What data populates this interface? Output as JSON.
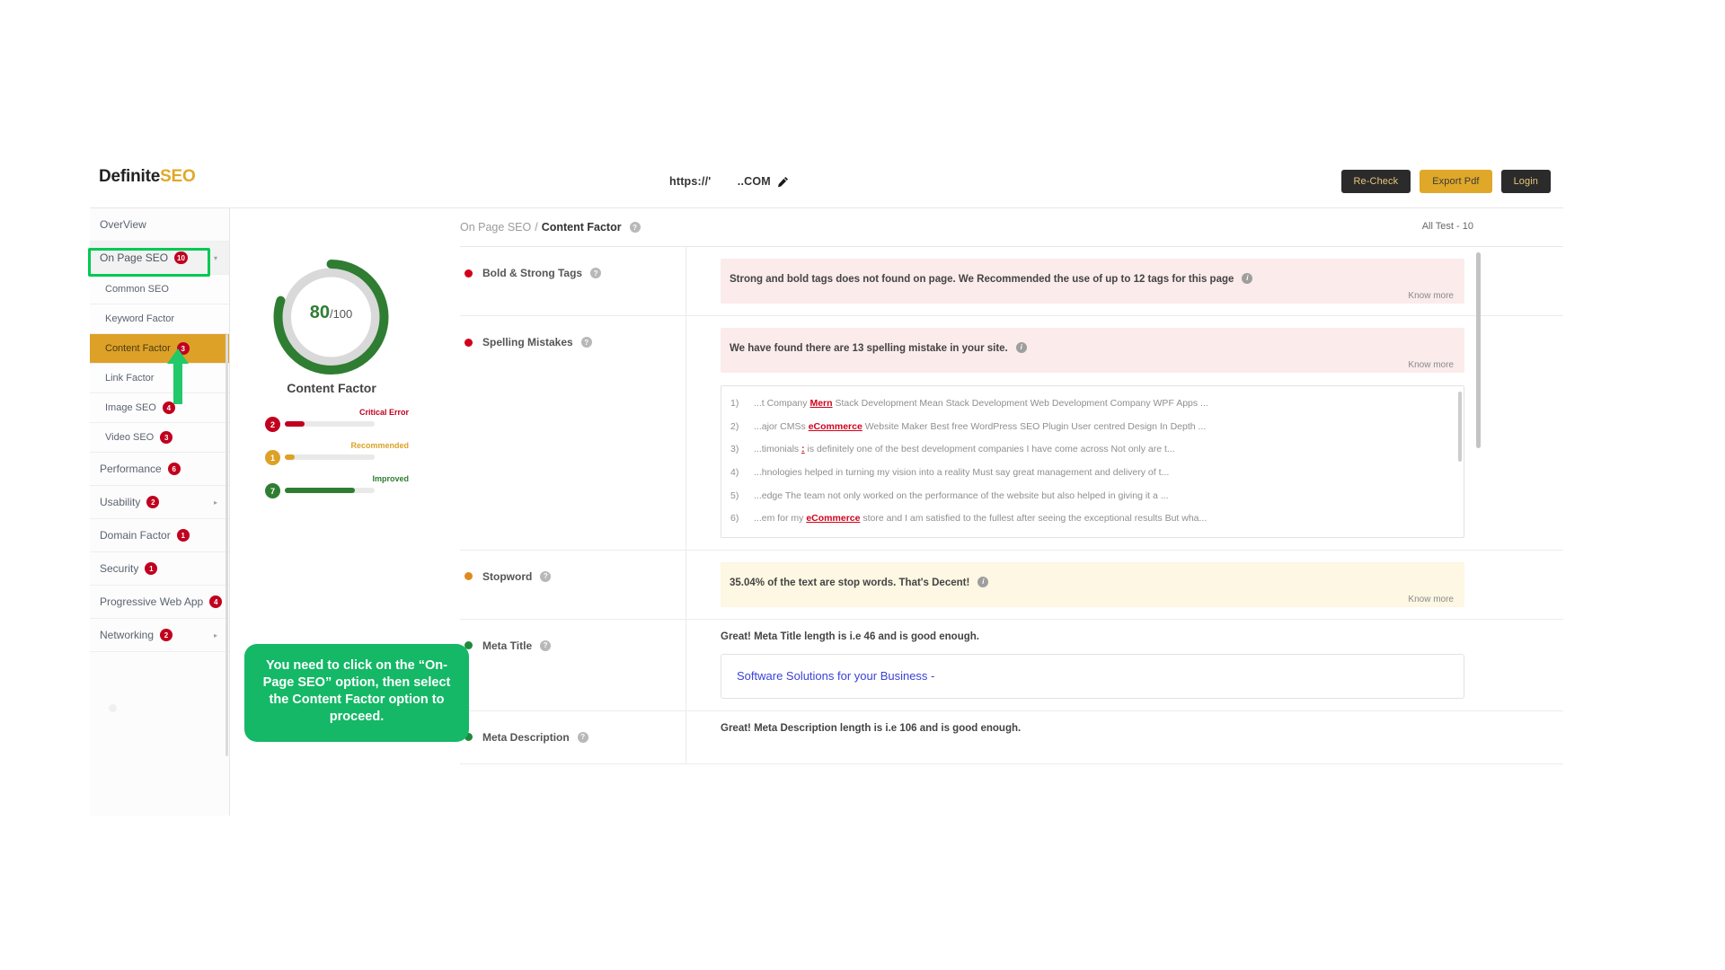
{
  "header": {
    "logo_primary": "Definite",
    "logo_accent": "SEO",
    "url": "https://'        ..COM",
    "edit_icon": "pencil-icon",
    "buttons": {
      "recheck": "Re-Check",
      "export": "Export Pdf",
      "login": "Login"
    }
  },
  "sidebar": {
    "items": [
      {
        "label": "OverView",
        "badge": "",
        "caret": "",
        "state": "normal"
      },
      {
        "label": "On Page SEO",
        "badge": "10",
        "caret": "▾",
        "state": "group-open"
      },
      {
        "label": "Common SEO",
        "badge": "",
        "caret": "",
        "state": "sub"
      },
      {
        "label": "Keyword Factor",
        "badge": "",
        "caret": "",
        "state": "sub"
      },
      {
        "label": "Content Factor",
        "badge": "3",
        "caret": "",
        "state": "sub-active"
      },
      {
        "label": "Link Factor",
        "badge": "",
        "caret": "",
        "state": "sub"
      },
      {
        "label": "Image SEO",
        "badge": "4",
        "caret": "",
        "state": "sub"
      },
      {
        "label": "Video SEO",
        "badge": "3",
        "caret": "",
        "state": "sub"
      },
      {
        "label": "Performance",
        "badge": "6",
        "caret": "",
        "state": "normal"
      },
      {
        "label": "Usability",
        "badge": "2",
        "caret": "▸",
        "state": "normal"
      },
      {
        "label": "Domain Factor",
        "badge": "1",
        "caret": "",
        "state": "normal"
      },
      {
        "label": "Security",
        "badge": "1",
        "caret": "",
        "state": "normal"
      },
      {
        "label": "Progressive Web App",
        "badge": "4",
        "caret": "",
        "state": "normal"
      },
      {
        "label": "Networking",
        "badge": "2",
        "caret": "▸",
        "state": "normal"
      }
    ]
  },
  "score": {
    "value": "80",
    "max": "/100",
    "title": "Content Factor",
    "percent": 80,
    "arc_color": "#2f7d32",
    "legend": [
      {
        "count": "2",
        "label": "Critical Error",
        "color": "#c0001e",
        "fill": 22
      },
      {
        "count": "1",
        "label": "Recommended",
        "color": "#dda128",
        "fill": 11
      },
      {
        "count": "7",
        "label": "Improved",
        "color": "#2f7d32",
        "fill": 78
      }
    ]
  },
  "main": {
    "breadcrumb_parent": "On Page SEO",
    "breadcrumb_sep": "/",
    "breadcrumb_current": "Content Factor",
    "all_test": "All Test - 10",
    "know_more": "Know more",
    "rows": [
      {
        "label": "Bold & Strong Tags",
        "status": "critical",
        "dot_color": "#d0021b",
        "box": "red",
        "message": "Strong and bold tags does not found on page. We Recommended the use of up to 12 tags for this page",
        "has_know_more": true
      },
      {
        "label": "Spelling Mistakes",
        "status": "critical",
        "dot_color": "#d0021b",
        "box": "red",
        "message": "We have found there are 13 spelling mistake in your site.",
        "has_know_more": true,
        "list": [
          {
            "n": "1)",
            "pre": "...t Company ",
            "mark": "Mern",
            "post": " Stack Development Mean Stack Development Web Development Company WPF Apps ..."
          },
          {
            "n": "2)",
            "pre": "...ajor CMSs ",
            "mark": "eCommerce",
            "post": " Website Maker Best free WordPress SEO Plugin User centred Design In Depth ..."
          },
          {
            "n": "3)",
            "pre": "...timonials           ",
            "mark": ":",
            "post": " is definitely one of the best development companies I have come across Not only are t..."
          },
          {
            "n": "4)",
            "pre": "...hnologies           ",
            "mark": " ",
            "post": "helped in turning my vision into a reality Must say great management and delivery of t..."
          },
          {
            "n": "5)",
            "pre": "...edge The           ",
            "mark": " ",
            "post": "team not only worked on the performance of the website but also helped in giving it a ..."
          },
          {
            "n": "6)",
            "pre": "...em for my ",
            "mark": "eCommerce",
            "post": " store and I am satisfied to the fullest after seeing the exceptional results But wha..."
          }
        ]
      },
      {
        "label": "Stopword",
        "status": "warning",
        "dot_color": "#e08a1e",
        "box": "yellow",
        "message": "35.04% of the text are stop words. That's Decent!",
        "has_know_more": true
      },
      {
        "label": "Meta Title",
        "status": "good",
        "dot_color": "#1e8a3c",
        "box": "none",
        "message": "Great! Meta Title length is i.e 46 and is good enough.",
        "has_know_more": false,
        "title_value": "Software Solutions for your Business -"
      },
      {
        "label": "Meta Description",
        "status": "good",
        "dot_color": "#1e8a3c",
        "box": "none",
        "message": "Great! Meta Description length is i.e 106 and is good enough.",
        "has_know_more": false
      }
    ]
  },
  "callout": {
    "text": "You need to  click on the “On-Page SEO” option, then select the Content Factor option to proceed."
  }
}
